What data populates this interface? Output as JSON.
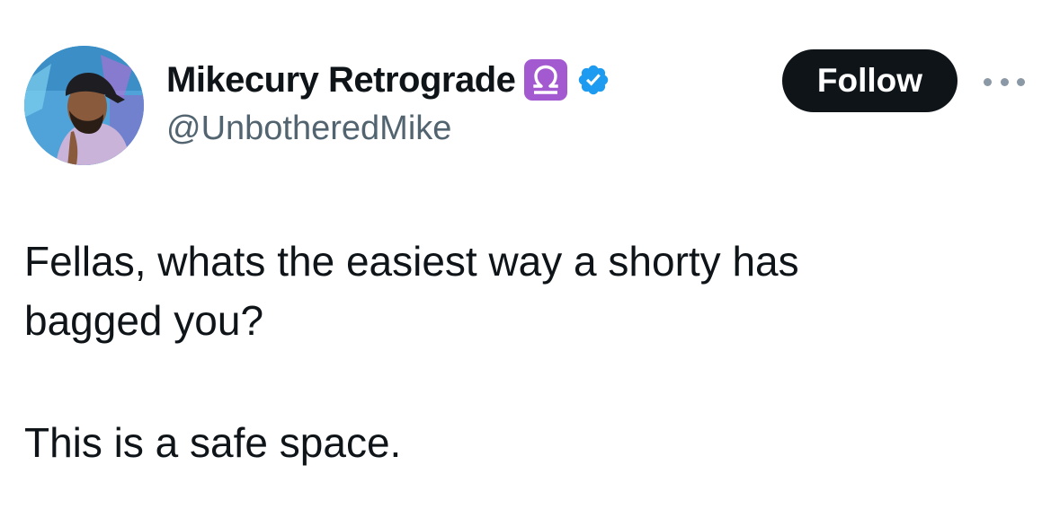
{
  "author": {
    "display_name": "Mikecury Retrograde",
    "handle": "@UnbotheredMike",
    "libra_glyph": "♎",
    "badge_color": "#a35ad1",
    "verified_color": "#1d9bf0",
    "avatar_icon": "avatar-photo"
  },
  "actions": {
    "follow_label": "Follow",
    "more_icon": "more-horizontal-icon"
  },
  "tweet": {
    "line1": "Fellas, whats the easiest way a shorty has",
    "line2": "bagged you?",
    "line3": "This is a safe space."
  }
}
